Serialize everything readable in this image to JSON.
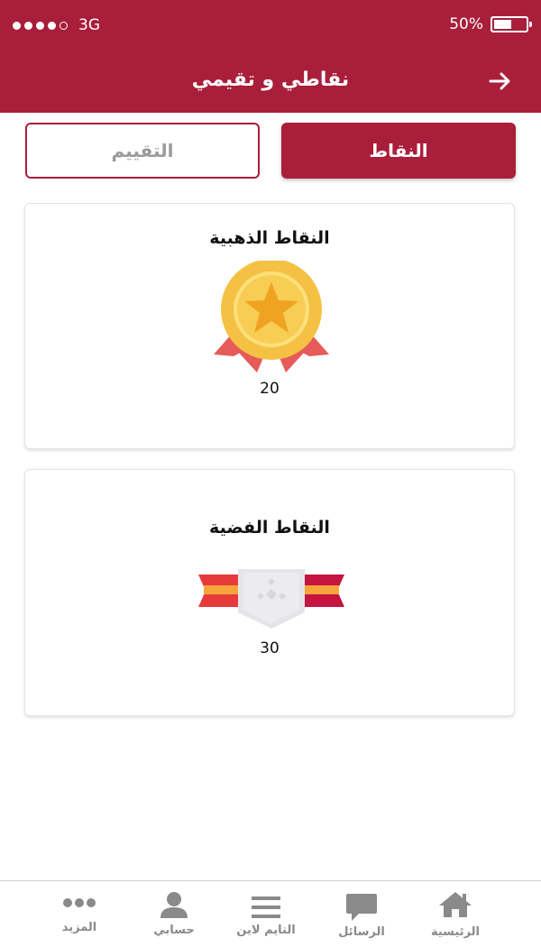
{
  "status_bar": {
    "carrier": "3G",
    "battery": "50%"
  },
  "header": {
    "title": "نقاطي و تقيمي"
  },
  "tabs": {
    "points": "النقاط",
    "rating": "التقييم"
  },
  "gold": {
    "title": "النقاط الذهبية",
    "value": "20"
  },
  "silver": {
    "title": "النقاط الفضية",
    "value": "30"
  },
  "tabbar": {
    "home": "الرئيسية",
    "messages": "الرسائل",
    "timeline": "التايم لاين",
    "account": "حسابي",
    "more": "المزيد"
  },
  "colors": {
    "brand": "#a91e3a",
    "gold": "#f5c144",
    "ribbon": "#e65a5a",
    "silver": "#e4e5e8"
  }
}
